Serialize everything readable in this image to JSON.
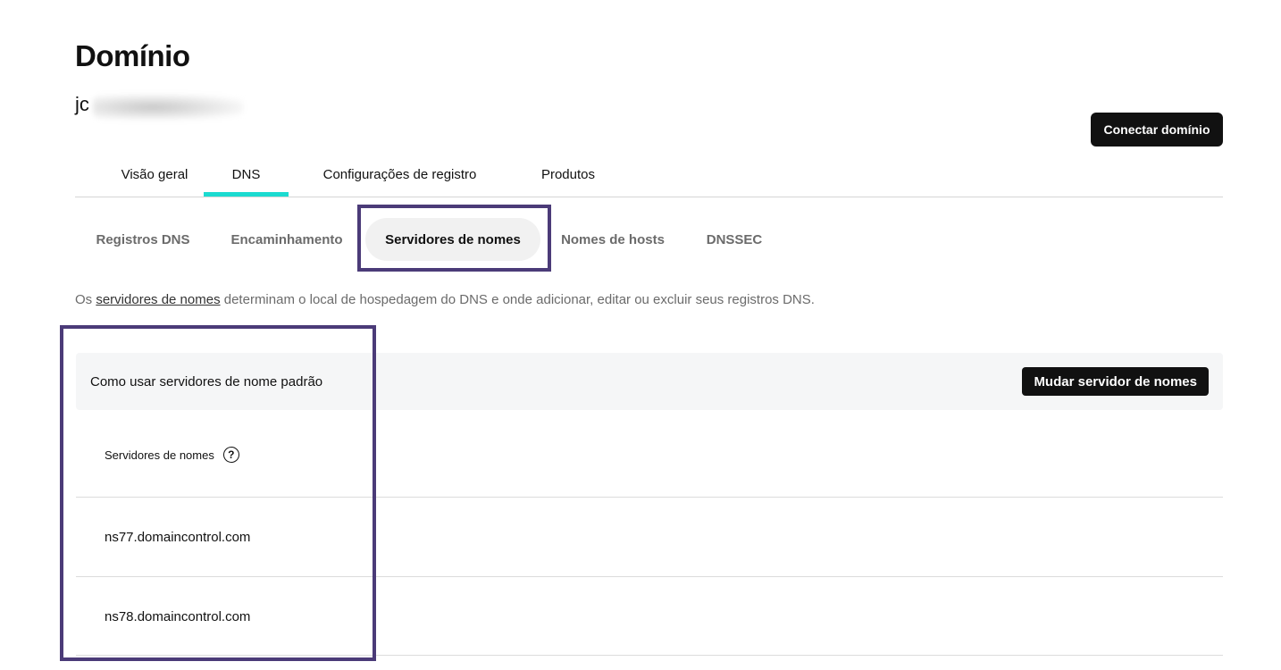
{
  "page": {
    "title": "Domínio",
    "domain_visible": "jc",
    "connect_button": "Conectar domínio"
  },
  "main_tabs": [
    {
      "label": "Visão geral",
      "active": false
    },
    {
      "label": "DNS",
      "active": true
    },
    {
      "label": "Configurações de registro",
      "active": false
    },
    {
      "label": "Produtos",
      "active": false
    }
  ],
  "sub_tabs": [
    {
      "label": "Registros DNS",
      "active": false
    },
    {
      "label": "Encaminhamento",
      "active": false
    },
    {
      "label": "Servidores de nomes",
      "active": true
    },
    {
      "label": "Nomes de hosts",
      "active": false
    },
    {
      "label": "DNSSEC",
      "active": false
    }
  ],
  "description": {
    "prefix": "Os",
    "link": "servidores de nomes",
    "suffix": "determinam o local de hospedagem do DNS e onde adicionar, editar ou excluir seus registros DNS."
  },
  "info_bar": {
    "text": "Como usar servidores de nome padrão",
    "button": "Mudar servidor de nomes"
  },
  "nameservers": {
    "header": "Servidores de nomes",
    "help_glyph": "?",
    "items": [
      "ns77.domaincontrol.com",
      "ns78.domaincontrol.com"
    ]
  },
  "colors": {
    "tab_indicator": "#1bdbd0",
    "highlight_border": "#4b3b78",
    "button_bg": "#111111"
  }
}
